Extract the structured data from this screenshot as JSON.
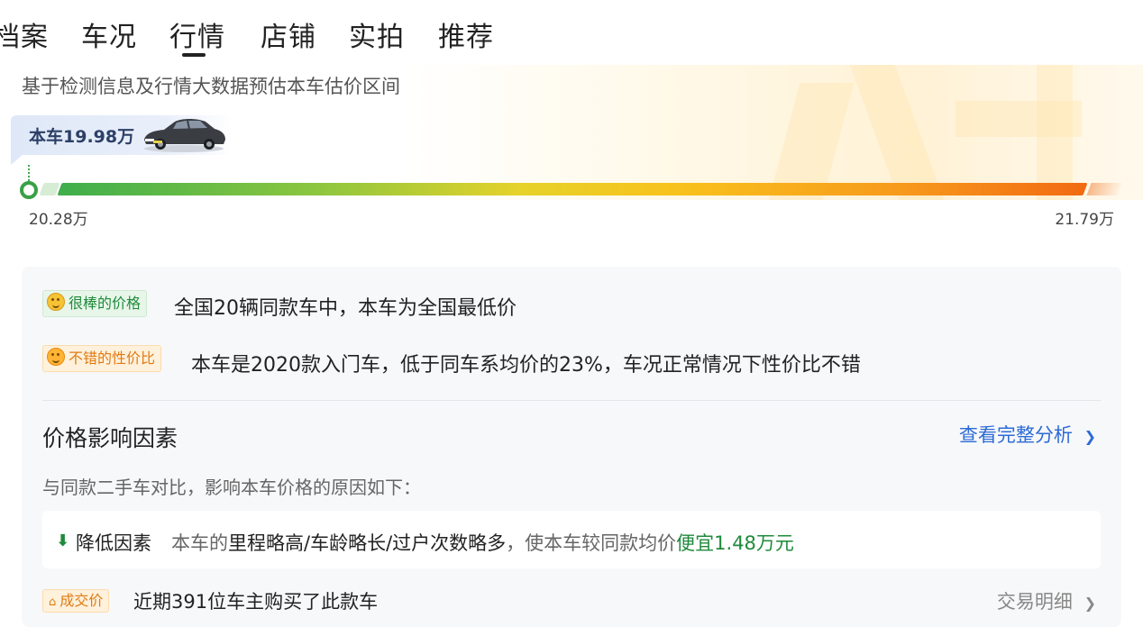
{
  "tabs": [
    {
      "label": "档案"
    },
    {
      "label": "车况"
    },
    {
      "label": "行情",
      "active": true
    },
    {
      "label": "店铺"
    },
    {
      "label": "实拍"
    },
    {
      "label": "推荐"
    }
  ],
  "estimate": {
    "subtitle": "基于检测信息及行情大数据预估本车估价区间",
    "current_price_label": "本车19.98万",
    "range_min": "20.28万",
    "range_max": "21.79万",
    "car_image_alt": "car-thumbnail"
  },
  "tags": [
    {
      "label": "很棒的价格",
      "text": "全国20辆同款车中，本车为全国最低价",
      "color": "#1f8a3b"
    },
    {
      "label": "不错的性价比",
      "text": "本车是2020款入门车，低于同车系均价的23%，车况正常情况下性价比不错",
      "color": "#e07b12"
    }
  ],
  "factors": {
    "title": "价格影响因素",
    "link_label": "查看完整分析",
    "link_arrow": "❯",
    "description": "与同款二手车对比，影响本车价格的原因如下：",
    "reduce": {
      "arrow": "⬇",
      "label": "降低因素",
      "prefix": "本车的",
      "items": "里程略高/车龄略长/过户次数略多",
      "middle": "，使本车较同款均价",
      "highlight": "便宜1.48万元"
    }
  },
  "deal": {
    "tag": "成交价",
    "text": "近期391位车主购买了此款车",
    "link_label": "交易明细",
    "link_arrow": "❯"
  }
}
